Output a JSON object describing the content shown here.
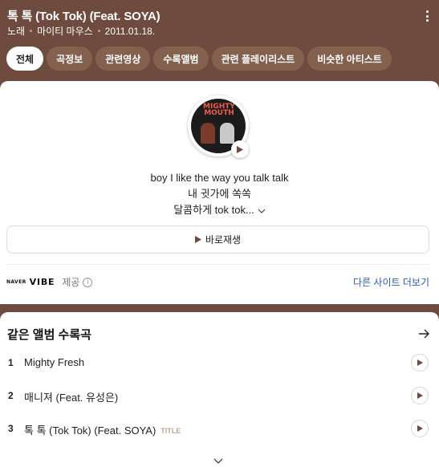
{
  "header": {
    "title": "톡 톡 (Tok Tok) (Feat. SOYA)",
    "meta": [
      "노래",
      "마이티 마우스",
      "2011.01.18."
    ]
  },
  "tabs": [
    {
      "label": "전체",
      "active": true
    },
    {
      "label": "곡정보",
      "active": false
    },
    {
      "label": "관련영상",
      "active": false
    },
    {
      "label": "수록앨범",
      "active": false
    },
    {
      "label": "관련 플레이리스트",
      "active": false
    },
    {
      "label": "비슷한 아티스트",
      "active": false
    }
  ],
  "album": {
    "art_text": "MIGHTY MOUTH",
    "lyrics": [
      "boy I like the way you talk talk",
      "내 귓가에 쏙쏙",
      "달콤하게 tok tok..."
    ]
  },
  "play_button": {
    "label": "바로재생"
  },
  "provider": {
    "naver": "NAVER",
    "vibe": "VIBE",
    "provided": "제공",
    "info_icon": "i",
    "other_sites": "다른 사이트 더보기"
  },
  "tracks_section": {
    "title": "같은 앨범 수록곡",
    "tracks": [
      {
        "num": "1",
        "name": "Mighty Fresh",
        "badge": ""
      },
      {
        "num": "2",
        "name": "매니져 (Feat. 유성은)",
        "badge": ""
      },
      {
        "num": "3",
        "name": "톡 톡 (Tok Tok) (Feat. SOYA)",
        "badge": "TITLE"
      }
    ]
  },
  "colors": {
    "brand_brown": "#6f4a3f",
    "tab_bg": "#84604f",
    "link_blue": "#2c5bb6"
  }
}
